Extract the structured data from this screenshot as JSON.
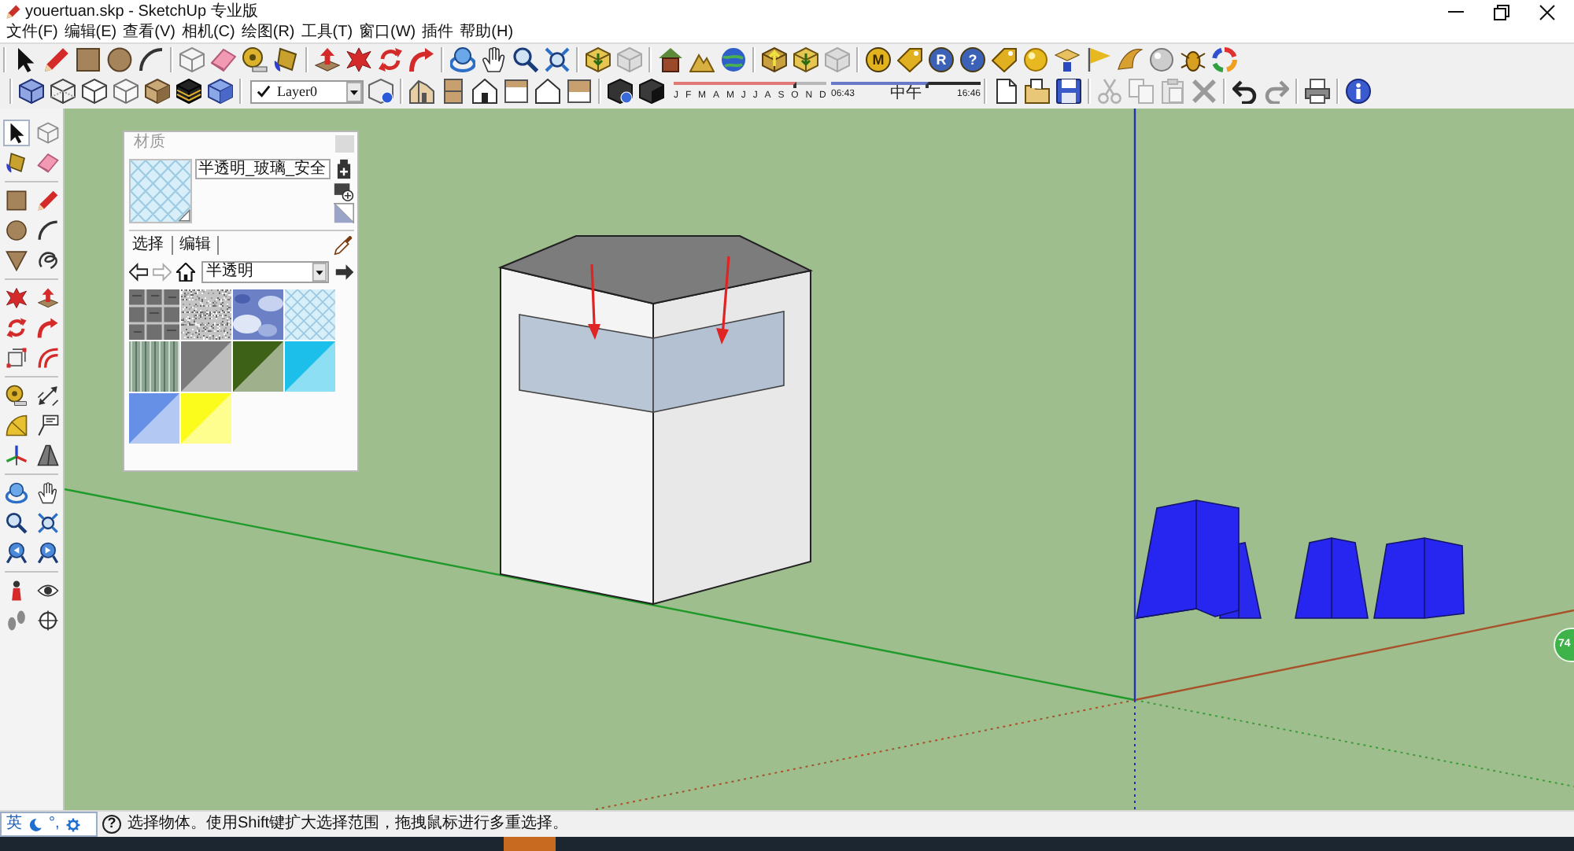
{
  "window": {
    "title": "youertuan.skp - SketchUp 专业版"
  },
  "menu_bar": {
    "items": [
      "文件(F)",
      "编辑(E)",
      "查看(V)",
      "相机(C)",
      "绘图(R)",
      "工具(T)",
      "窗口(W)",
      "插件",
      "帮助(H)"
    ]
  },
  "toolbar": {
    "plugin_buttons": [
      {
        "label": "M",
        "color": "#e2b31c"
      },
      {
        "label": "R",
        "color": "#3b62b6"
      },
      {
        "label": "?",
        "color": "#3b62b6"
      }
    ],
    "layer_dropdown": {
      "value": "Layer0"
    },
    "shadow_settings": {
      "date_slider": {
        "level": 0.8
      },
      "months": [
        "J",
        "F",
        "M",
        "A",
        "M",
        "J",
        "J",
        "A",
        "S",
        "O",
        "N",
        "D"
      ],
      "time_slider": {
        "level": 0.65
      },
      "time_start": "06:43",
      "time_noon": "中午",
      "time_end": "16:46"
    },
    "standard_buttons": [
      {
        "disabled": false
      },
      {
        "disabled": false
      },
      {
        "disabled": false
      },
      {
        "disabled": true
      },
      {
        "disabled": true
      },
      {
        "disabled": true
      },
      {
        "disabled": true
      },
      {
        "disabled": false
      },
      {
        "disabled": true
      },
      {
        "disabled": false
      },
      {
        "disabled": false
      }
    ]
  },
  "tools_palette": {
    "tools": [
      {
        "selected": true
      },
      {
        "selected": false
      },
      {
        "selected": false
      },
      {
        "selected": false
      },
      {
        "selected": false
      },
      {
        "selected": false
      },
      {
        "selected": false
      },
      {
        "selected": false
      },
      {
        "selected": false
      },
      {
        "selected": false
      },
      {
        "selected": false
      },
      {
        "selected": false
      },
      {
        "selected": false
      },
      {
        "selected": false
      },
      {
        "selected": false
      },
      {
        "selected": false
      },
      {
        "selected": false
      },
      {
        "selected": false
      },
      {
        "selected": false
      },
      {
        "selected": false
      },
      {
        "selected": false
      },
      {
        "selected": false
      },
      {
        "selected": false
      },
      {
        "selected": false
      },
      {
        "selected": false
      },
      {
        "selected": false
      },
      {
        "selected": false
      },
      {
        "selected": false
      },
      {
        "selected": false
      },
      {
        "selected": false
      },
      {
        "selected": false
      },
      {
        "selected": false
      }
    ]
  },
  "materials_panel": {
    "title": "材质",
    "preview": {
      "kind": "crosshatch"
    },
    "material_name": "半透明_玻璃_安全",
    "tabs": [
      {
        "label": "选择",
        "selected": true
      },
      {
        "label": "编辑",
        "selected": false
      }
    ],
    "collection": "半透明",
    "swatches": [
      {
        "kind": "grid",
        "color": "#6f6f6f"
      },
      {
        "kind": "speckle",
        "color": "#c4c4c4"
      },
      {
        "kind": "cloud",
        "color": "#6c80c6"
      },
      {
        "kind": "crosshatch",
        "color": "#d8eef8"
      },
      {
        "kind": "stripes",
        "color": "#8ea694"
      },
      {
        "kind": "split",
        "color": "#7b7b7b"
      },
      {
        "kind": "split",
        "color": "#3e6118"
      },
      {
        "kind": "split",
        "color": "#1bbfe9"
      },
      {
        "kind": "split",
        "color": "#6690e6"
      },
      {
        "kind": "split",
        "color": "#fcfc1c"
      }
    ]
  },
  "viewport": {
    "badge": "74"
  },
  "status_bar": {
    "ime": {
      "language": "英",
      "punctuation": "°,"
    },
    "help": "?",
    "message": "选择物体。使用Shift键扩大选择范围，拖拽鼠标进行多重选择。"
  }
}
